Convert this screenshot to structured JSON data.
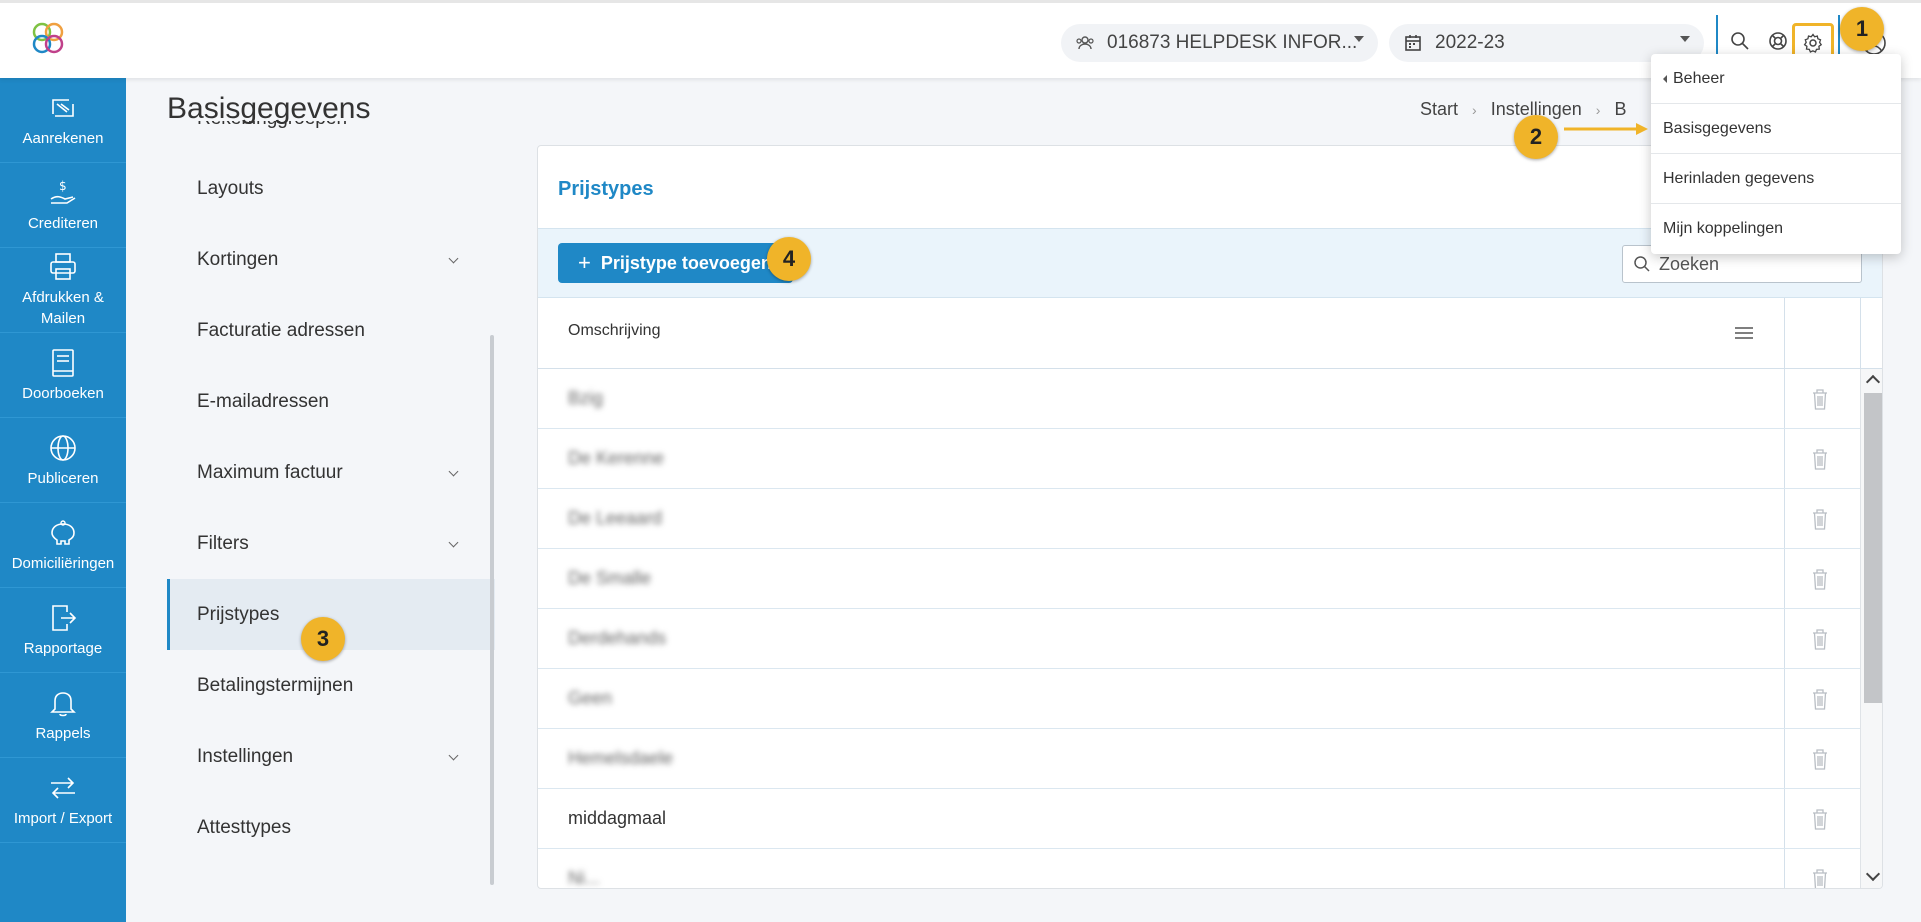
{
  "header": {
    "org_selector": "016873 HELPDESK INFOR...",
    "year_selector": "2022-23"
  },
  "leftnav": {
    "items": [
      {
        "label": "Aanrekenen",
        "icon": "invoice-icon"
      },
      {
        "label": "Crediteren",
        "icon": "credit-hand-icon"
      },
      {
        "label": "Afdrukken & Mailen",
        "icon": "printer-icon"
      },
      {
        "label": "Doorboeken",
        "icon": "book-icon"
      },
      {
        "label": "Publiceren",
        "icon": "globe-icon"
      },
      {
        "label": "Domiciliëringen",
        "icon": "piggy-bank-icon"
      },
      {
        "label": "Rapportage",
        "icon": "report-export-icon"
      },
      {
        "label": "Rappels",
        "icon": "bell-icon"
      },
      {
        "label": "Import / Export",
        "icon": "swap-arrows-icon"
      }
    ]
  },
  "page": {
    "title": "Basisgegevens",
    "breadcrumb": [
      "Start",
      "Instellingen",
      "B"
    ]
  },
  "submenu": {
    "cut_item": "Rekeninggroepen",
    "items": [
      {
        "label": "Layouts",
        "expandable": false
      },
      {
        "label": "Kortingen",
        "expandable": true
      },
      {
        "label": "Facturatie adressen",
        "expandable": false
      },
      {
        "label": "E-mailadressen",
        "expandable": false
      },
      {
        "label": "Maximum factuur",
        "expandable": true
      },
      {
        "label": "Filters",
        "expandable": true
      },
      {
        "label": "Prijstypes",
        "expandable": false,
        "active": true
      },
      {
        "label": "Betalingstermijnen",
        "expandable": false
      },
      {
        "label": "Instellingen",
        "expandable": true
      },
      {
        "label": "Attesttypes",
        "expandable": false
      }
    ]
  },
  "card": {
    "title": "Prijstypes",
    "add_button": "Prijstype toevoegen",
    "search_placeholder": "Zoeken",
    "column_header": "Omschrijving",
    "rows": [
      {
        "label": "Bzig",
        "blurred": true
      },
      {
        "label": "De Kerenne",
        "blurred": true
      },
      {
        "label": "De Leeaard",
        "blurred": true
      },
      {
        "label": "De Smalle",
        "blurred": true
      },
      {
        "label": "Derdehands",
        "blurred": true
      },
      {
        "label": "Geen",
        "blurred": true
      },
      {
        "label": "Hemelsdaele",
        "blurred": true
      },
      {
        "label": "middagmaal",
        "blurred": false
      },
      {
        "label": "Ni...",
        "blurred": true
      }
    ]
  },
  "dropdown": {
    "back": "Beheer",
    "items": [
      "Basisgegevens",
      "Herinladen gegevens",
      "Mijn koppelingen"
    ]
  },
  "annotations": [
    "1",
    "2",
    "3",
    "4"
  ],
  "colors": {
    "primary": "#1f88c6",
    "badge": "#f0b429",
    "active_bg": "#e4ebf2"
  }
}
